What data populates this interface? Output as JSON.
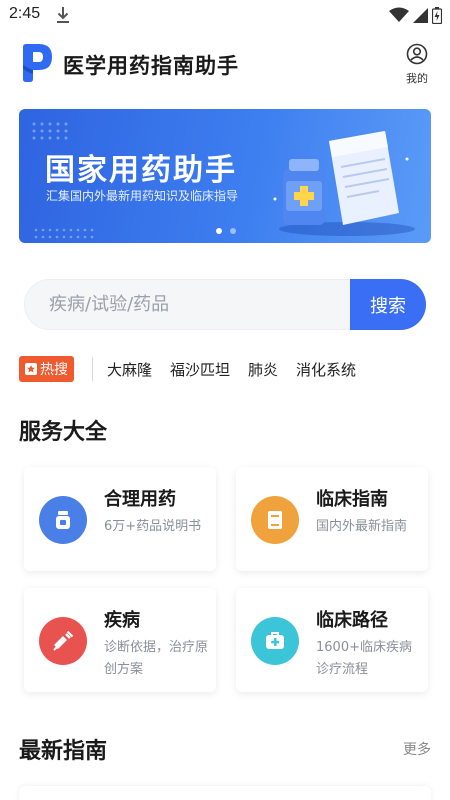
{
  "status_bar": {
    "time": "2:45"
  },
  "header": {
    "title": "医学用药指南助手",
    "profile_label": "我的"
  },
  "banner": {
    "title": "国家用药助手",
    "subtitle": "汇集国内外最新用药知识及临床指导",
    "slides": 2,
    "active_slide": 1
  },
  "search": {
    "placeholder": "疾病/试验/药品",
    "value": "",
    "button_label": "搜索"
  },
  "hot": {
    "badge_label": "热搜",
    "tags": [
      "大麻隆",
      "福沙匹坦",
      "肺炎",
      "消化系统"
    ]
  },
  "services": {
    "title": "服务大全",
    "items": [
      {
        "title": "合理用药",
        "desc": "6万+药品说明书",
        "icon": "medicine-bottle-icon",
        "color": "#4a7fe8"
      },
      {
        "title": "临床指南",
        "desc": "国内外最新指南",
        "icon": "book-icon",
        "color": "#f0a33c"
      },
      {
        "title": "疾病",
        "desc": "诊断依据，治疗原创方案",
        "icon": "syringe-icon",
        "color": "#e8524f"
      },
      {
        "title": "临床路径",
        "desc": "1600+临床疾病诊疗流程",
        "icon": "medical-kit-icon",
        "color": "#3cc4d8"
      }
    ]
  },
  "latest": {
    "title": "最新指南",
    "more_label": "更多"
  },
  "colors": {
    "accent": "#3a6ff5",
    "hot": "#ef5a2f"
  }
}
